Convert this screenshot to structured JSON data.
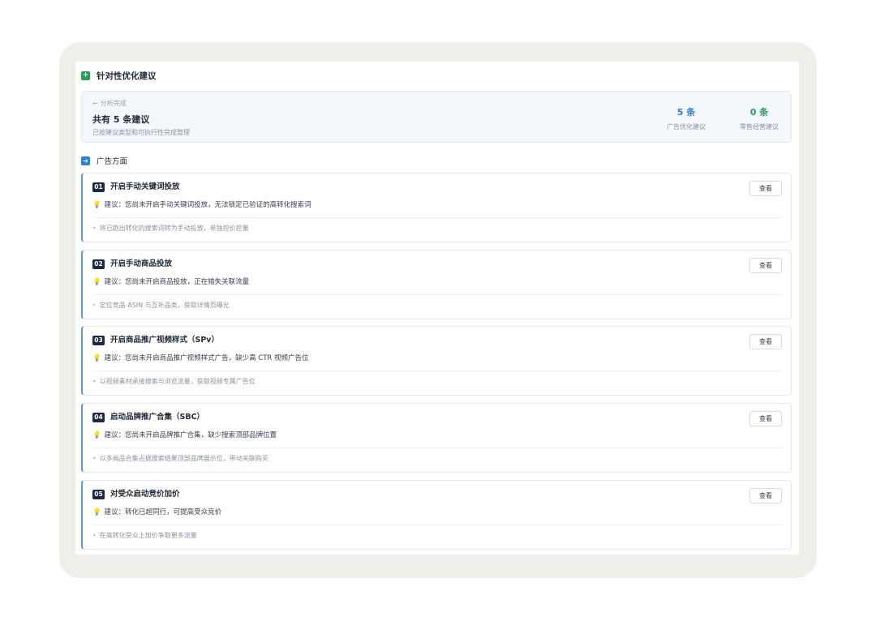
{
  "header": {
    "title": "针对性优化建议"
  },
  "summary": {
    "status": "分析完成",
    "total": "共有 5 条建议",
    "subtitle": "已按建议类型和可执行性完成整理",
    "stats": [
      {
        "value": "5 条",
        "label": "广告优化建议"
      },
      {
        "value": "0 条",
        "label": "零售经营建议"
      }
    ]
  },
  "section": {
    "title": "广告方面"
  },
  "cards": [
    {
      "num": "01",
      "title": "开启手动关键词投放",
      "suggestion": "建议：您尚未开启手动关键词投放，无法锁定已验证的高转化搜索词",
      "note": "将已跑出转化的搜索词转为手动投放，单独控价控量",
      "button": "查看"
    },
    {
      "num": "02",
      "title": "开启手动商品投放",
      "suggestion": "建议：您尚未开启商品投放，正在错失关联流量",
      "note": "定位竞品 ASIN 与互补品类，获取详情页曝光",
      "button": "查看"
    },
    {
      "num": "03",
      "title": "开启商品推广视频样式（SPv）",
      "suggestion": "建议：您尚未开启商品推广视频样式广告，缺少高 CTR 视频广告位",
      "note": "以视频素材承接搜索与浏览流量，获取视频专属广告位",
      "button": "查看"
    },
    {
      "num": "04",
      "title": "启动品牌推广合集（SBC）",
      "suggestion": "建议：您尚未开启品牌推广合集，缺少搜索顶部品牌位置",
      "note": "以多商品合集占据搜索结果顶部品牌展示位，带动关联购买",
      "button": "查看"
    },
    {
      "num": "05",
      "title": "对受众启动竞价加价",
      "suggestion": "建议：转化已超同行，可提高受众竞价",
      "note": "在高转化受众上加价争取更多流量",
      "button": "查看"
    }
  ]
}
